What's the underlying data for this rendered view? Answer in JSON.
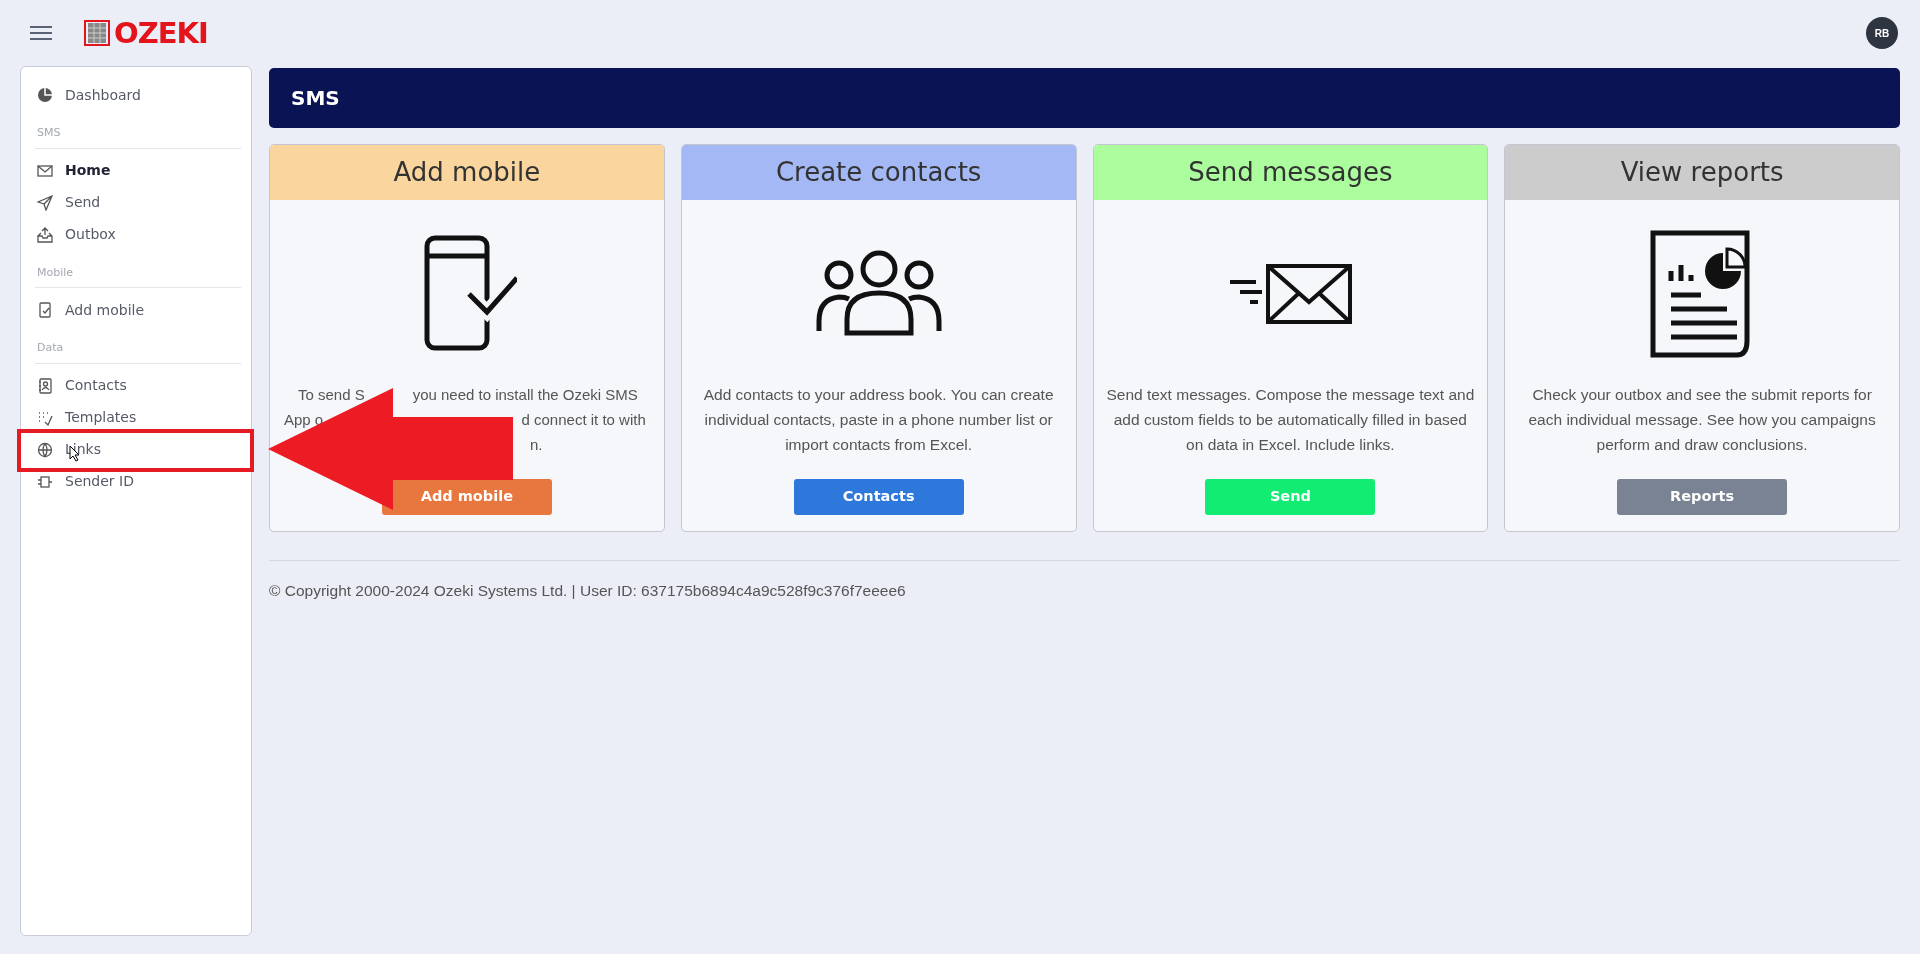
{
  "brand": {
    "name": "OZEKI"
  },
  "user": {
    "initials": "RB"
  },
  "sidebar": {
    "sections": [
      {
        "items": [
          {
            "label": "Dashboard",
            "selected": false
          }
        ]
      },
      {
        "heading": "SMS",
        "items": [
          {
            "label": "Home",
            "selected": true
          },
          {
            "label": "Send",
            "selected": false
          },
          {
            "label": "Outbox",
            "selected": false
          }
        ]
      },
      {
        "heading": "Mobile",
        "items": [
          {
            "label": "Add mobile",
            "selected": false
          }
        ]
      },
      {
        "heading": "Data",
        "items": [
          {
            "label": "Contacts",
            "selected": false
          },
          {
            "label": "Templates",
            "selected": false
          },
          {
            "label": "Links",
            "selected": false
          },
          {
            "label": "Sender ID",
            "selected": false
          }
        ]
      }
    ]
  },
  "page_title": "SMS",
  "cards": [
    {
      "title": "Add mobile",
      "color": "#fad59e",
      "description_lines": [
        [
          "To send S",
          "you need to install the Ozeki SMS"
        ],
        [
          "App o",
          "d connect it to with"
        ],
        [
          "n."
        ]
      ],
      "button": {
        "label": "Add mobile",
        "color": "#e8773f"
      }
    },
    {
      "title": "Create contacts",
      "color": "#a3b8f5",
      "description": "Add contacts to your address book. You can create individual contacts, paste in a phone number list or import contacts from Excel.",
      "button": {
        "label": "Contacts",
        "color": "#2f78db"
      }
    },
    {
      "title": "Send messages",
      "color": "#abfd9e",
      "description": "Send text messages. Compose the message text and add custom fields to be automatically filled in based on data in Excel. Include links.",
      "button": {
        "label": "Send",
        "color": "#12ec72"
      }
    },
    {
      "title": "View reports",
      "color": "#cccccc",
      "description": "Check your outbox and see the submit reports for each individual message. See how you campaigns perform and draw conclusions.",
      "button": {
        "label": "Reports",
        "color": "#7a8394"
      }
    }
  ],
  "footer": "© Copyright 2000-2024 Ozeki Systems Ltd. | User ID: 637175b6894c4a9c528f9c376f7eeee6"
}
